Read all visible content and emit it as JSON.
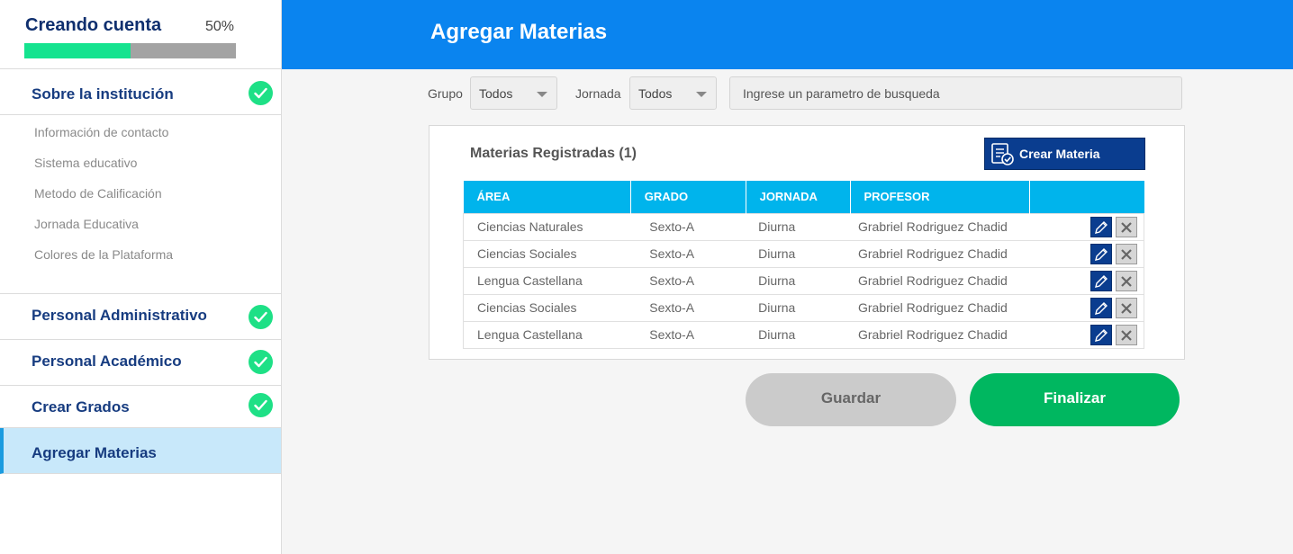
{
  "sidebar": {
    "progress": {
      "title": "Creando cuenta",
      "percent_label": "50%",
      "fraction": 0.5
    },
    "sections": {
      "institucion": {
        "label": "Sobre la institución",
        "completed": true
      },
      "admin": {
        "label": "Personal Administrativo",
        "completed": true
      },
      "academico": {
        "label": "Personal Académico",
        "completed": true
      },
      "grados": {
        "label": "Crear Grados",
        "completed": true
      },
      "materias": {
        "label": "Agregar Materias",
        "active": true
      }
    },
    "sub_items": [
      "Información de contacto",
      "Sistema educativo",
      "Metodo de Calificación",
      "Jornada Educativa",
      "Colores de la Plataforma"
    ]
  },
  "header": {
    "title": "Agregar Materias"
  },
  "filters": {
    "grupo_label": "Grupo",
    "grupo_value": "Todos",
    "jornada_label": "Jornada",
    "jornada_value": "Todos",
    "search_placeholder": "Ingrese un parametro de busqueda"
  },
  "card": {
    "title": "Materias Registradas (1)",
    "create_button": "Crear Materia"
  },
  "table": {
    "headers": [
      "ÁREA",
      "GRADO",
      "JORNADA",
      "PROFESOR"
    ],
    "rows": [
      [
        "Ciencias Naturales",
        "Sexto-A",
        "Diurna",
        "Grabriel Rodriguez Chadid"
      ],
      [
        "Ciencias Sociales",
        "Sexto-A",
        "Diurna",
        "Grabriel Rodriguez Chadid"
      ],
      [
        "Lengua Castellana",
        "Sexto-A",
        "Diurna",
        "Grabriel Rodriguez Chadid"
      ],
      [
        "Ciencias Sociales",
        "Sexto-A",
        "Diurna",
        "Grabriel Rodriguez Chadid"
      ],
      [
        "Lengua Castellana",
        "Sexto-A",
        "Diurna",
        "Grabriel Rodriguez Chadid"
      ]
    ]
  },
  "actions": {
    "save": "Guardar",
    "finish": "Finalizar"
  },
  "colors": {
    "header_bg": "#0a84ef",
    "sidebar_title": "#173c80",
    "progress_fill": "#15e38f",
    "check": "#1ee086",
    "table_header": "#00b4ec",
    "create_button": "#0a3d8f",
    "finish_button": "#00b760",
    "save_button": "#cbcbcb",
    "active_section_bg": "#c8e8fa"
  },
  "icons": {
    "check": "check-icon",
    "edit": "pencil-icon",
    "delete": "x-icon",
    "create": "document-check-icon",
    "dropdown": "caret-down-icon"
  }
}
